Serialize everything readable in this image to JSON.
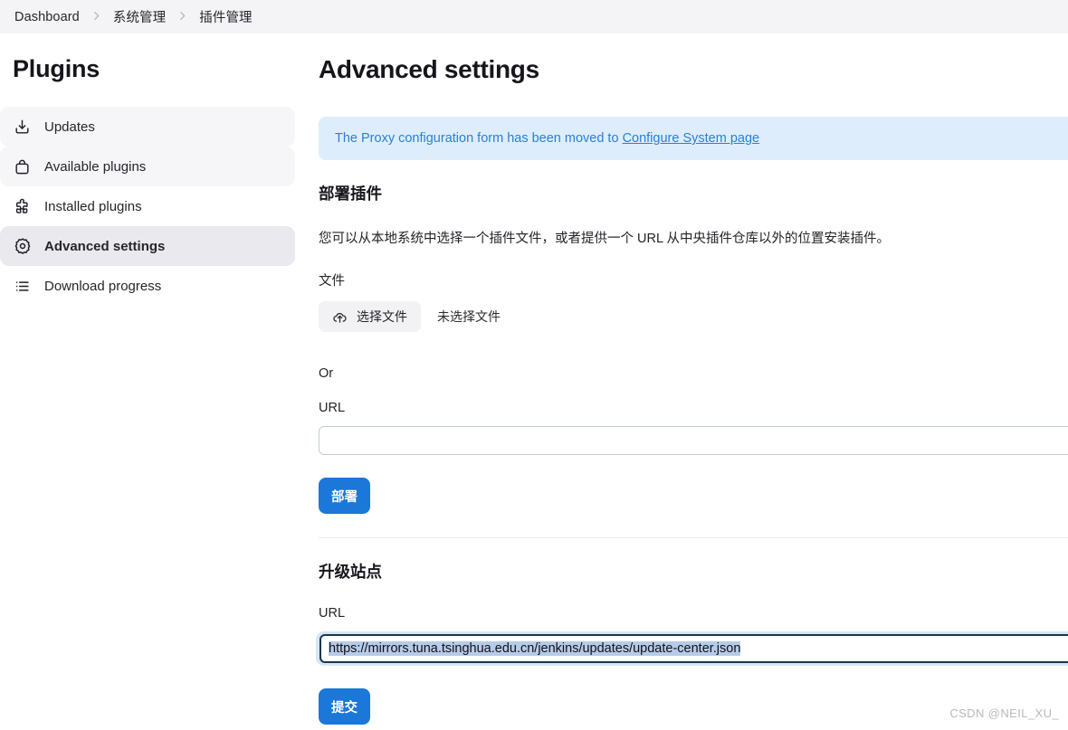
{
  "breadcrumb": {
    "items": [
      {
        "label": "Dashboard"
      },
      {
        "label": "系统管理"
      },
      {
        "label": "插件管理"
      }
    ]
  },
  "sidebar": {
    "title": "Plugins",
    "items": [
      {
        "label": "Updates",
        "icon": "download-tray-icon",
        "state": "hovered"
      },
      {
        "label": "Available plugins",
        "icon": "bag-icon",
        "state": "hovered"
      },
      {
        "label": "Installed plugins",
        "icon": "puzzle-piece-icon",
        "state": "normal"
      },
      {
        "label": "Advanced settings",
        "icon": "gear-icon",
        "state": "active"
      },
      {
        "label": "Download progress",
        "icon": "list-icon",
        "state": "normal"
      }
    ]
  },
  "main": {
    "title": "Advanced settings",
    "alert": {
      "text": "The Proxy configuration form has been moved to ",
      "link_label": "Configure System page"
    },
    "deploy_section": {
      "heading": "部署插件",
      "description": "您可以从本地系统中选择一个插件文件，或者提供一个 URL 从中央插件仓库以外的位置安装插件。",
      "file_label": "文件",
      "file_button_label": "选择文件",
      "file_button_icon": "upload-cloud-icon",
      "file_status": "未选择文件",
      "or_label": "Or",
      "url_label": "URL",
      "url_value": "",
      "url_placeholder": "",
      "submit_label": "部署"
    },
    "upgrade_section": {
      "heading": "升级站点",
      "url_label": "URL",
      "url_value": "https://mirrors.tuna.tsinghua.edu.cn/jenkins/updates/update-center.json",
      "submit_label": "提交"
    }
  },
  "watermark": "CSDN @NEIL_XU_",
  "colors": {
    "accent_blue": "#1b77d8",
    "alert_bg": "#ddedfb",
    "alert_text": "#2b7fd6",
    "selection_bg": "#b6cbe8",
    "focus_ring": "#18374e",
    "breadcrumb_bg": "#f4f4f7",
    "sidebar_active_bg": "#e9e9ee"
  }
}
